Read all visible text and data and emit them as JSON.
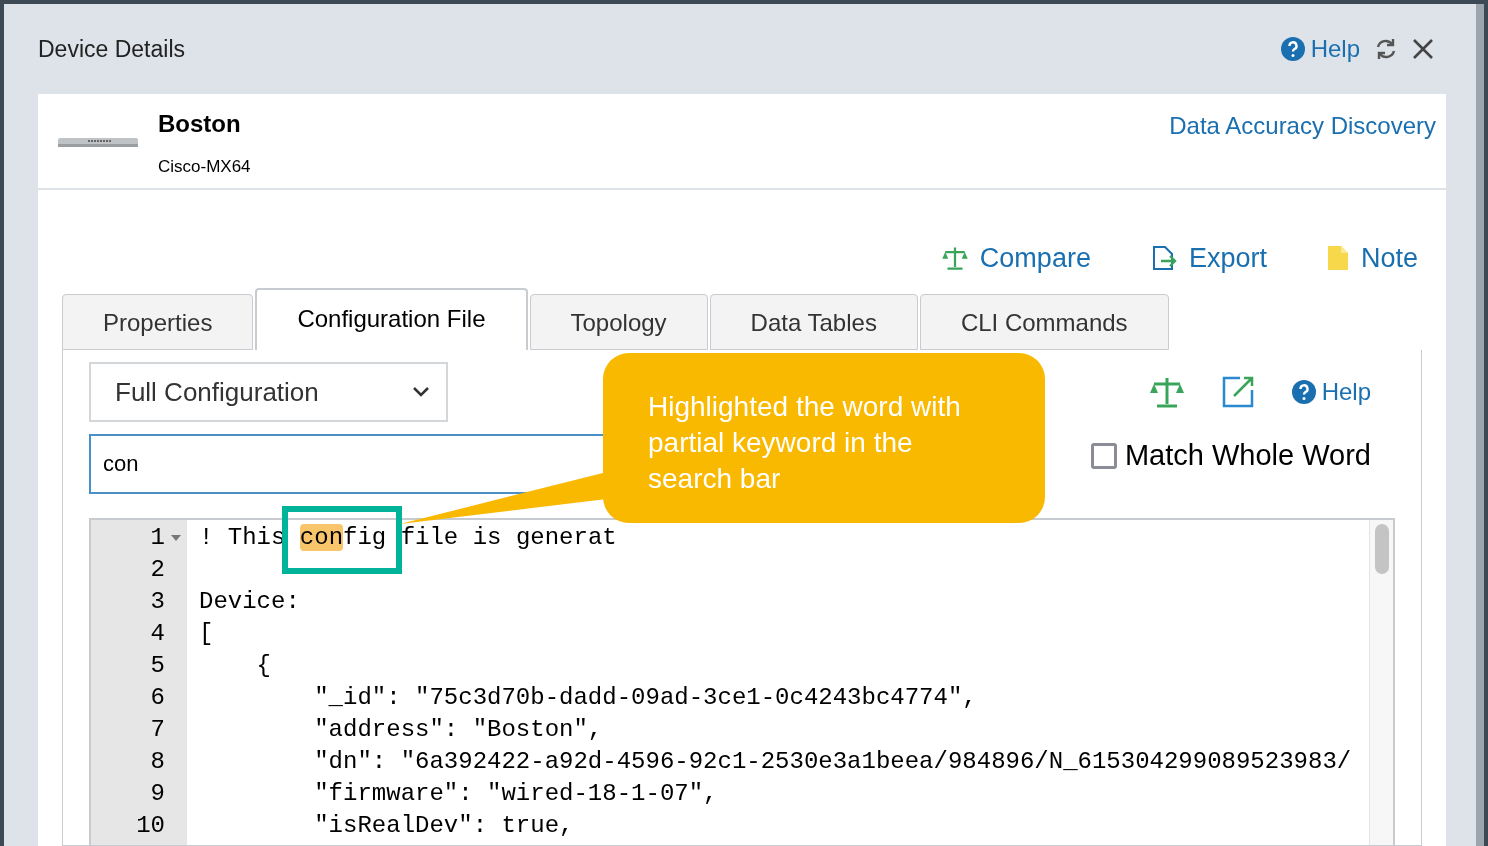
{
  "window": {
    "title": "Device Details",
    "help": "Help"
  },
  "device": {
    "name": "Boston",
    "model": "Cisco-MX64",
    "link": "Data Accuracy Discovery"
  },
  "actions": [
    {
      "label": "Compare",
      "kind": "compare"
    },
    {
      "label": "Export",
      "kind": "export"
    },
    {
      "label": "Note",
      "kind": "note"
    }
  ],
  "tabs": [
    {
      "label": "Properties",
      "selected": false
    },
    {
      "label": "Configuration File",
      "selected": true
    },
    {
      "label": "Topology",
      "selected": false
    },
    {
      "label": "Data Tables",
      "selected": false
    },
    {
      "label": "CLI Commands",
      "selected": false
    }
  ],
  "config": {
    "view": "Full Configuration",
    "search": "con",
    "help": "Help",
    "match_whole_word": {
      "label": "Match Whole Word",
      "checked": false
    },
    "lines": [
      {
        "number": "1",
        "foldable": true,
        "parts": [
          {
            "text": "! This ",
            "highlighted": false
          },
          {
            "text": "con",
            "highlighted": true
          },
          {
            "text": "fig file is generat",
            "highlighted": false
          }
        ]
      },
      {
        "number": "2",
        "foldable": false
      },
      {
        "number": "3",
        "foldable": false,
        "parts": [
          {
            "text": "Device:",
            "highlighted": false
          }
        ]
      },
      {
        "number": "4",
        "foldable": false,
        "parts": [
          {
            "text": "[",
            "highlighted": false
          }
        ]
      },
      {
        "number": "5",
        "foldable": false,
        "parts": [
          {
            "text": "    {",
            "highlighted": false
          }
        ]
      },
      {
        "number": "6",
        "foldable": false,
        "parts": [
          {
            "text": "        \"_id\": \"75c3d70b-dadd-09ad-3ce1-0c4243bc4774\",",
            "highlighted": false
          }
        ]
      },
      {
        "number": "7",
        "foldable": false,
        "parts": [
          {
            "text": "        \"address\": \"Boston\",",
            "highlighted": false
          }
        ]
      },
      {
        "number": "8",
        "foldable": false,
        "parts": [
          {
            "text": "        \"dn\": \"6a392422-a92d-4596-92c1-2530e3a1beea/984896/N_615304299089523983/",
            "highlighted": false
          }
        ]
      },
      {
        "number": "9",
        "foldable": false,
        "parts": [
          {
            "text": "        \"firmware\": \"wired-18-1-07\",",
            "highlighted": false
          }
        ]
      },
      {
        "number": "10",
        "foldable": false,
        "parts": [
          {
            "text": "        \"isRealDev\": true,",
            "highlighted": false
          }
        ]
      }
    ]
  },
  "callout": {
    "text": "Highlighted the word with partial keyword in the search bar"
  }
}
